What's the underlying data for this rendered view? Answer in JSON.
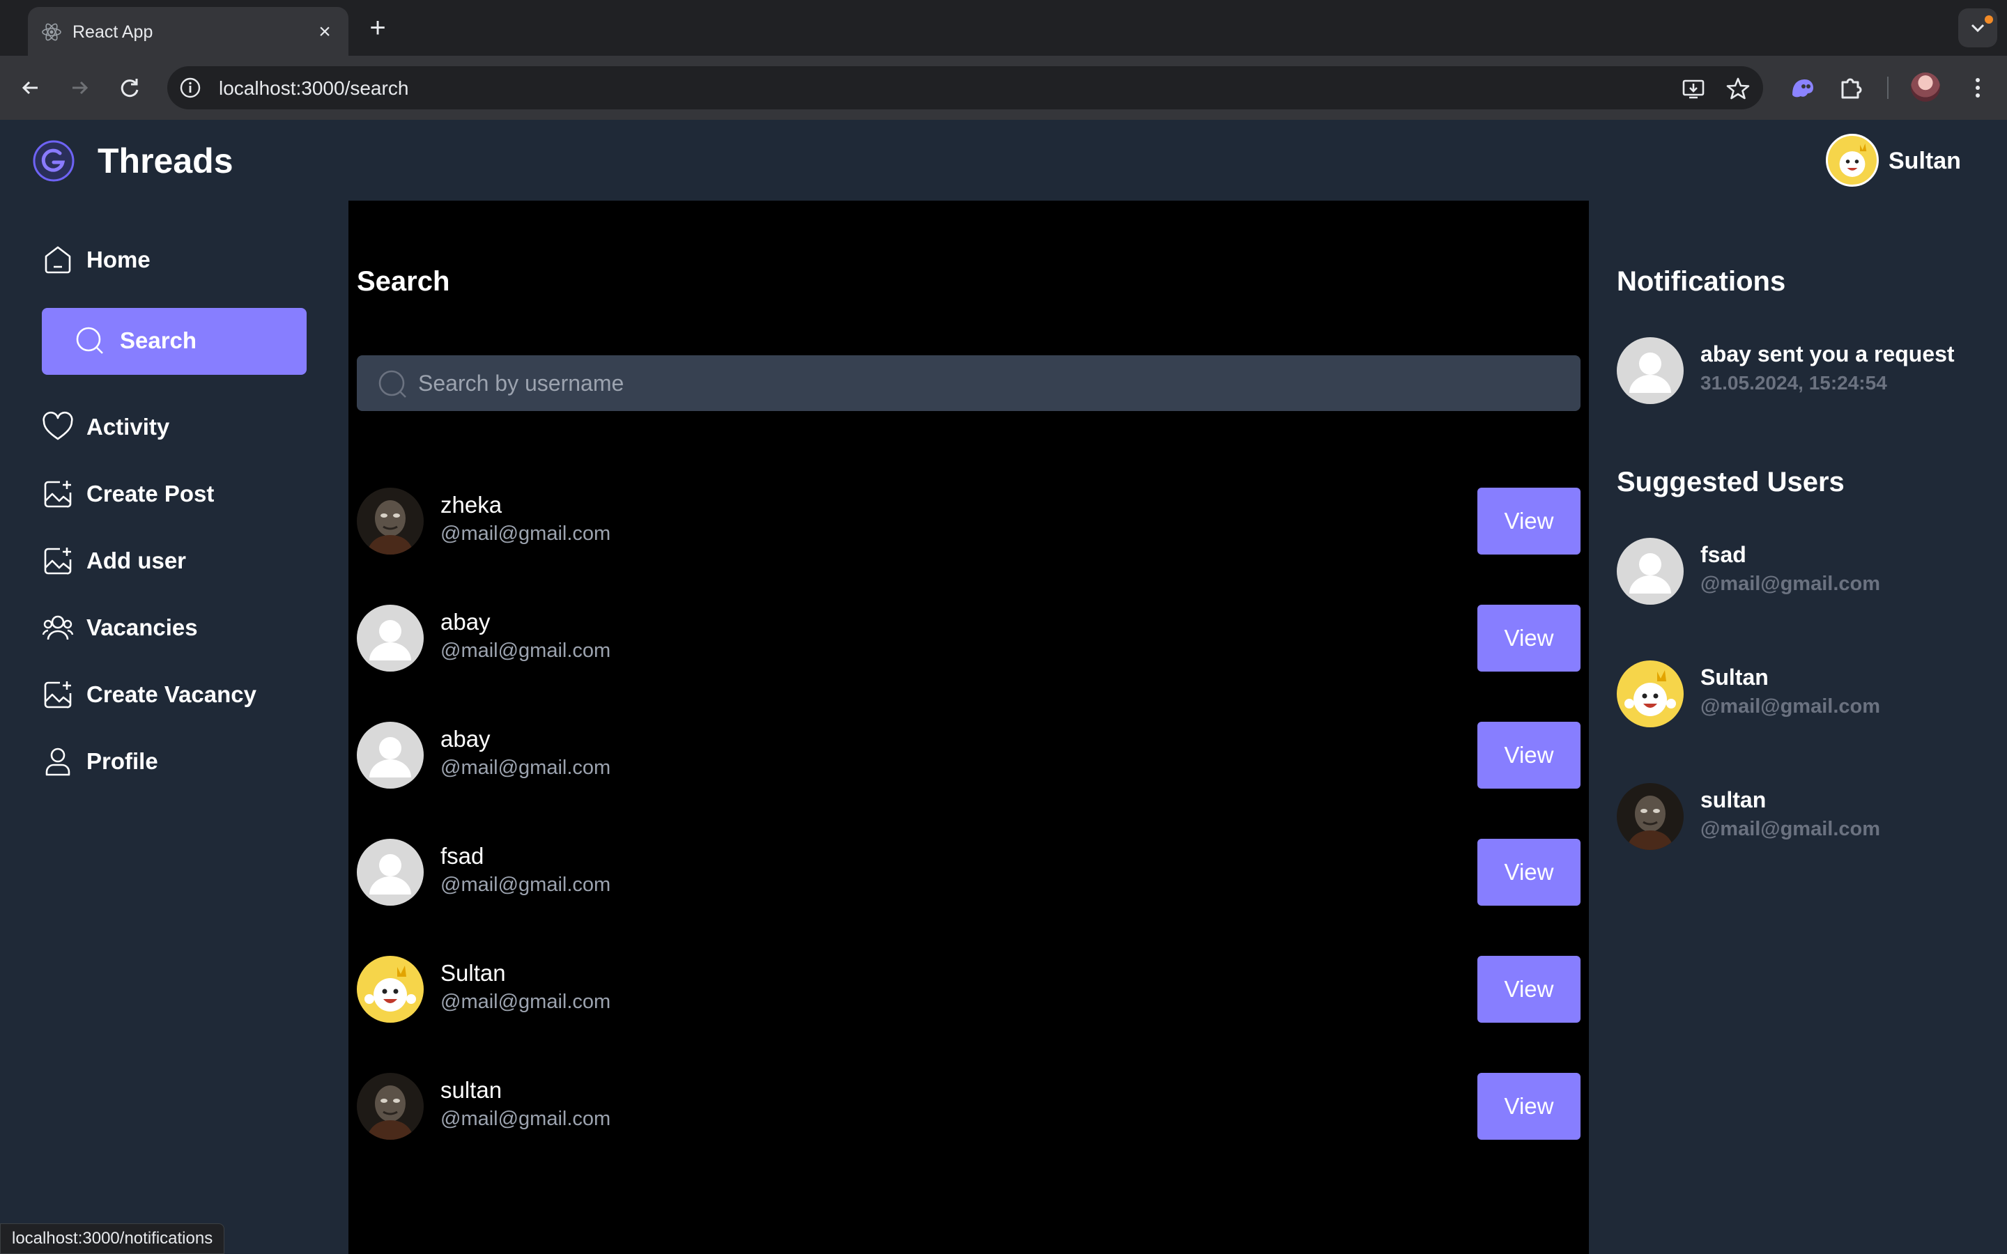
{
  "browser": {
    "tab_title": "React App",
    "url": "localhost:3000/search",
    "status_url": "localhost:3000/notifications"
  },
  "app": {
    "name": "Threads",
    "current_user": "Sultan",
    "accent": "#877eff"
  },
  "sidebar": {
    "items": [
      {
        "label": "Home",
        "icon": "home-icon"
      },
      {
        "label": "Search",
        "icon": "search-icon",
        "active": true
      },
      {
        "label": "Activity",
        "icon": "heart-icon"
      },
      {
        "label": "Create Post",
        "icon": "image-plus-icon"
      },
      {
        "label": "Add user",
        "icon": "image-plus-icon"
      },
      {
        "label": "Vacancies",
        "icon": "users-icon"
      },
      {
        "label": "Create Vacancy",
        "icon": "image-plus-icon"
      },
      {
        "label": "Profile",
        "icon": "user-icon"
      }
    ]
  },
  "main": {
    "title": "Search",
    "search_placeholder": "Search by username",
    "view_label": "View",
    "results": [
      {
        "name": "zheka",
        "email": "@mail@gmail.com",
        "avatar": "dark"
      },
      {
        "name": "abay",
        "email": "@mail@gmail.com",
        "avatar": "default"
      },
      {
        "name": "abay",
        "email": "@mail@gmail.com",
        "avatar": "default"
      },
      {
        "name": "fsad",
        "email": "@mail@gmail.com",
        "avatar": "default"
      },
      {
        "name": "Sultan",
        "email": "@mail@gmail.com",
        "avatar": "yellow"
      },
      {
        "name": "sultan",
        "email": "@mail@gmail.com",
        "avatar": "dark"
      }
    ]
  },
  "right": {
    "notifications_title": "Notifications",
    "notification": {
      "text": "abay sent you a request",
      "time": "31.05.2024, 15:24:54"
    },
    "suggested_title": "Suggested Users",
    "suggested": [
      {
        "name": "fsad",
        "email": "@mail@gmail.com",
        "avatar": "default"
      },
      {
        "name": "Sultan",
        "email": "@mail@gmail.com",
        "avatar": "yellow"
      },
      {
        "name": "sultan",
        "email": "@mail@gmail.com",
        "avatar": "dark"
      }
    ]
  }
}
